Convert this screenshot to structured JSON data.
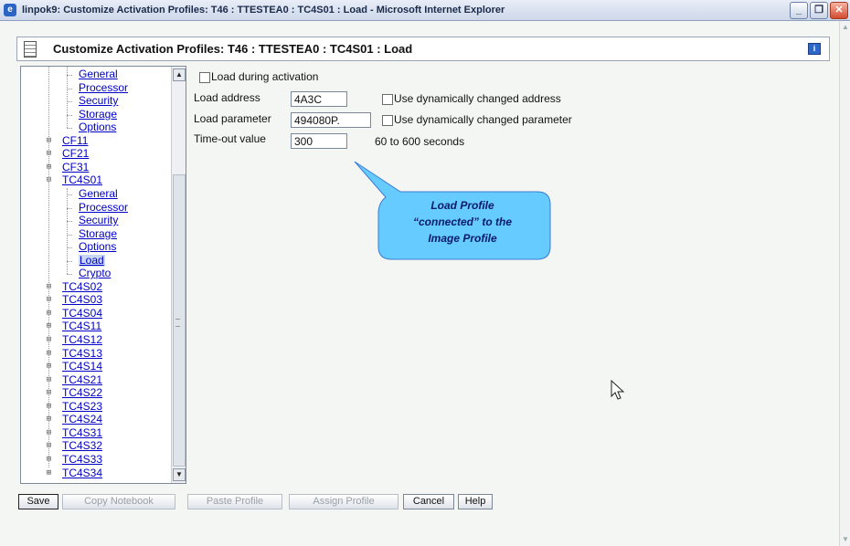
{
  "window": {
    "title": "linpok9: Customize Activation Profiles: T46 : TTESTEA0 : TC4S01 : Load - Microsoft Internet Explorer",
    "controls": [
      "minimize",
      "restore",
      "close"
    ]
  },
  "header": {
    "title": "Customize Activation Profiles: T46 : TTESTEA0 : TC4S01 : Load",
    "notebook_icon": "notebook-icon",
    "info_icon": "info-icon"
  },
  "tree": {
    "items": [
      {
        "label": "General",
        "level": 2
      },
      {
        "label": "Processor",
        "level": 2
      },
      {
        "label": "Security",
        "level": 2
      },
      {
        "label": "Storage",
        "level": 2
      },
      {
        "label": "Options",
        "level": 2
      },
      {
        "label": "CF11",
        "level": 1
      },
      {
        "label": "CF21",
        "level": 1
      },
      {
        "label": "CF31",
        "level": 1
      },
      {
        "label": "TC4S01",
        "level": 1
      },
      {
        "label": "General",
        "level": 2
      },
      {
        "label": "Processor",
        "level": 2
      },
      {
        "label": "Security",
        "level": 2
      },
      {
        "label": "Storage",
        "level": 2
      },
      {
        "label": "Options",
        "level": 2
      },
      {
        "label": "Load",
        "level": 2,
        "selected": true
      },
      {
        "label": "Crypto",
        "level": 2
      },
      {
        "label": "TC4S02",
        "level": 1
      },
      {
        "label": "TC4S03",
        "level": 1
      },
      {
        "label": "TC4S04",
        "level": 1
      },
      {
        "label": "TC4S11",
        "level": 1
      },
      {
        "label": "TC4S12",
        "level": 1
      },
      {
        "label": "TC4S13",
        "level": 1
      },
      {
        "label": "TC4S14",
        "level": 1
      },
      {
        "label": "TC4S21",
        "level": 1
      },
      {
        "label": "TC4S22",
        "level": 1
      },
      {
        "label": "TC4S23",
        "level": 1
      },
      {
        "label": "TC4S24",
        "level": 1
      },
      {
        "label": "TC4S31",
        "level": 1
      },
      {
        "label": "TC4S32",
        "level": 1
      },
      {
        "label": "TC4S33",
        "level": 1
      },
      {
        "label": "TC4S34",
        "level": 1
      }
    ]
  },
  "form": {
    "load_during_activation": "Load during activation",
    "load_address_label": "Load address",
    "load_address_value": "4A3C",
    "use_dyn_address": "Use dynamically changed address",
    "load_parameter_label": "Load parameter",
    "load_parameter_value": "494080P.",
    "use_dyn_parameter": "Use dynamically changed parameter",
    "timeout_label": "Time-out value",
    "timeout_value": "300",
    "timeout_hint": "60 to 600 seconds"
  },
  "callout": {
    "line1": "Load Profile",
    "line2": "“connected” to the",
    "line3": "Image Profile",
    "fill": "#66ccff"
  },
  "buttons": {
    "save": "Save",
    "copy_notebook": "Copy Notebook",
    "paste_profile": "Paste Profile",
    "assign_profile": "Assign Profile",
    "cancel": "Cancel",
    "help": "Help"
  }
}
